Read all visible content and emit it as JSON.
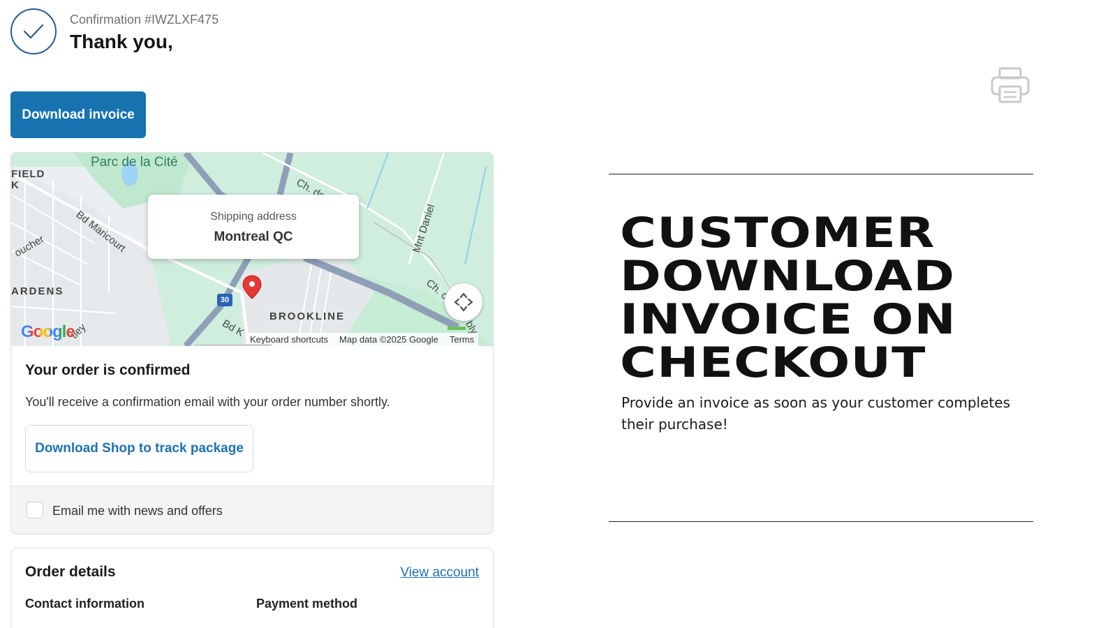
{
  "header": {
    "confirmation": "Confirmation #IWZLXF475",
    "thank_you": "Thank you,"
  },
  "actions": {
    "download_invoice": "Download invoice"
  },
  "icons": {
    "check": "check-icon",
    "print": "printer-icon",
    "expand": "expand-icon",
    "pin": "map-pin-icon"
  },
  "map": {
    "labels": {
      "park": "Parc de la Cité",
      "field": "FIELD",
      "k": "K",
      "boucher": "oucher",
      "maricourt": "Bd Maricourt",
      "gardens": "ARDENS",
      "ch_top": "Ch. de",
      "daniel": "Mnt Daniel",
      "ch_right": "Ch. c",
      "brookline": "BROOKLINE",
      "bdk": "Bd K",
      "tley": "tley",
      "bly": "bly",
      "hwy": "30"
    },
    "popup": {
      "label": "Shipping address",
      "city": "Montreal QC"
    },
    "google": "Google",
    "attribution": {
      "shortcuts": "Keyboard shortcuts",
      "data": "Map data ©2025 Google",
      "terms": "Terms"
    }
  },
  "order": {
    "title": "Your order is confirmed",
    "text": "You'll receive a confirmation email with your order number shortly.",
    "shop_button": "Download Shop to track package",
    "newsletter": "Email me with news and offers"
  },
  "details": {
    "title": "Order details",
    "view_account": "View account",
    "contact": "Contact information",
    "payment": "Payment method"
  },
  "promo": {
    "headline_lines": [
      "CUSTOMER",
      "DOWNLOAD",
      "INVOICE ON",
      "CHECKOUT"
    ],
    "subtext": "Provide an invoice as soon as your customer completes their purchase!"
  },
  "colors": {
    "primary": "#1773b0",
    "link": "#1f72b4",
    "map_green": "#cfeede",
    "pin_red": "#e53935"
  }
}
